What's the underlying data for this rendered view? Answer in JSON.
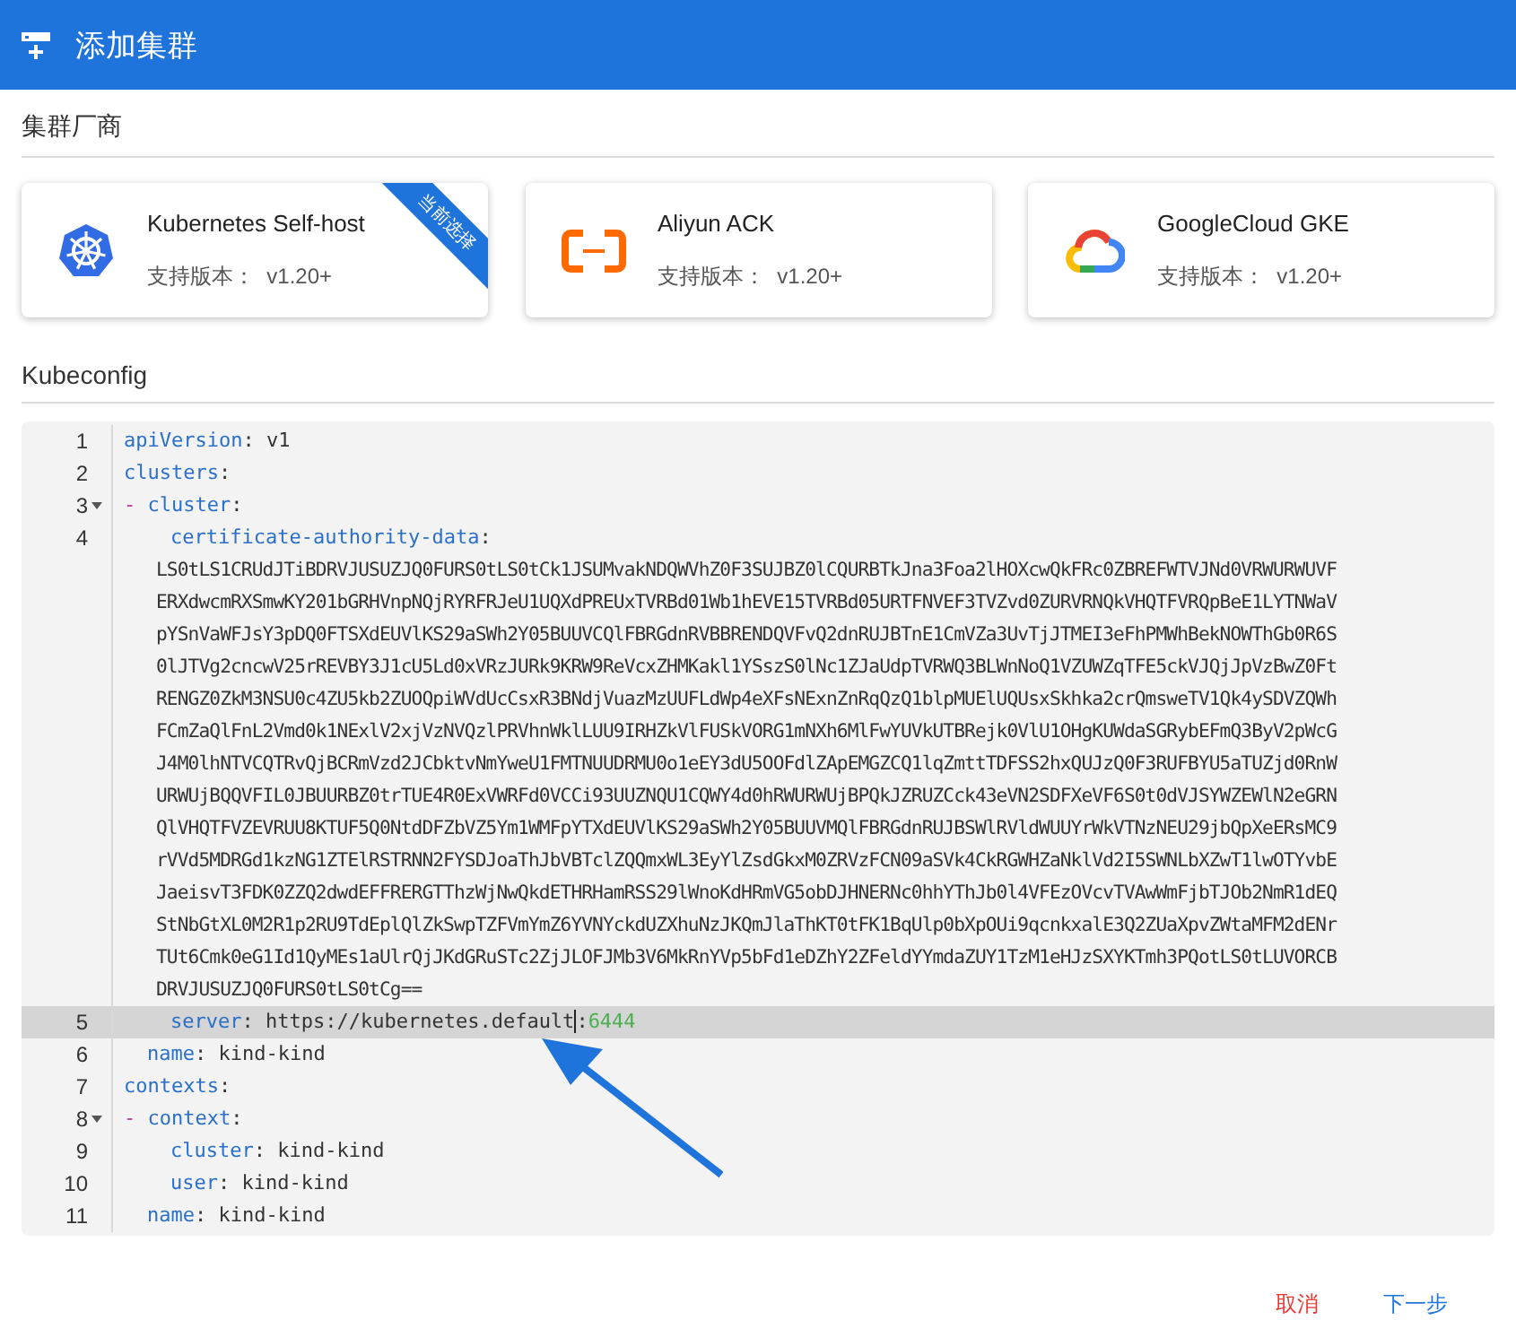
{
  "header": {
    "title": "添加集群"
  },
  "vendor_section": {
    "title": "集群厂商",
    "cards": [
      {
        "kind": "kubernetes",
        "name": "Kubernetes Self-host",
        "version_label": "支持版本：",
        "version": "v1.20+",
        "selected": true,
        "badge": "当前选择"
      },
      {
        "kind": "aliyun",
        "name": "Aliyun ACK",
        "version_label": "支持版本：",
        "version": "v1.20+",
        "selected": false
      },
      {
        "kind": "google-cloud",
        "name": "GoogleCloud GKE",
        "version_label": "支持版本：",
        "version": "v1.20+",
        "selected": false
      }
    ]
  },
  "kubeconfig_section": {
    "title": "Kubeconfig",
    "lines": [
      {
        "number": "1",
        "foldable": false,
        "highlighted": false,
        "parts": [
          {
            "kind": "key",
            "text": "apiVersion"
          },
          {
            "kind": "plain",
            "text": ": v1"
          }
        ]
      },
      {
        "number": "2",
        "foldable": false,
        "highlighted": false,
        "parts": [
          {
            "kind": "key",
            "text": "clusters"
          },
          {
            "kind": "plain",
            "text": ":"
          }
        ]
      },
      {
        "number": "3",
        "foldable": true,
        "highlighted": false,
        "parts": [
          {
            "kind": "dash",
            "text": "- "
          },
          {
            "kind": "key",
            "text": "cluster"
          },
          {
            "kind": "plain",
            "text": ":"
          }
        ]
      },
      {
        "number": "4",
        "kind": "deep",
        "foldable": false,
        "highlighted": false,
        "parts": [
          {
            "kind": "key",
            "text": "certificate-authority-data"
          },
          {
            "kind": "plain",
            "text": ":"
          }
        ],
        "wrapped": [
          "LS0tLS1CRUdJTiBDRVJUSUZJQ0FURS0tLS0tCk1JSUMvakNDQWVhZ0F3SUJBZ0lCQURBTkJna3Foa2lHOXcwQkFRc0ZBREFWTVJNd0VRWURWUVF",
          "ERXdwcmRXSmwKY201bGRHVnpNQjRYRFRJeU1UQXdPREUxTVRBd01Wb1hEVE15TVRBd05URTFNVEF3TVZvd0ZURVRNQkVHQTFVRQpBeE1LYTNWaV",
          "pYSnVaWFJsY3pDQ0FTSXdEUVlKS29aSWh2Y05BUUVCQlFBRGdnRVBBRENDQVFvQ2dnRUJBTnE1CmVZa3UvTjJTMEI3eFhPMWhBekNOWThGb0R6S",
          "0lJTVg2cncwV25rREVBY3J1cU5Ld0xVRzJURk9KRW9ReVcxZHMKakl1YSszS0lNc1ZJaUdpTVRWQ3BLWnNoQ1VZUWZqTFE5ckVJQjJpVzBwZ0Ft",
          "RENGZ0ZkM3NSU0c4ZU5kb2ZUOQpiWVdUcCsxR3BNdjVuazMzUUFLdWp4eXFsNExnZnRqQzQ1blpMUElUQUsxSkhka2crQmsweTV1Qk4ySDVZQWh",
          "FCmZaQlFnL2Vmd0k1NExlV2xjVzNVQzlPRVhnWklLUU9IRHZkVlFUSkVORG1mNXh6MlFwYUVkUTBRejk0VlU1OHgKUWdaSGRybEFmQ3ByV2pWcG",
          "J4M0lhNTVCQTRvQjBCRmVzd2JCbktvNmYweU1FMTNUUDRMU0o1eEY3dU5OOFdlZApEMGZCQ1lqZmttTDFSS2hxQUJzQ0F3RUFBYU5aTUZjd0RnW",
          "URWUjBQQVFIL0JBUURBZ0trTUE4R0ExVWRFd0VCCi93UUZNQU1CQWY4d0hRWURWUjBPQkJZRUZCck43eVN2SDFXeVF6S0t0dVJSYWZEWlN2eGRN",
          "QlVHQTFVZEVRUU8KTUF5Q0NtdDFZbVZ5Ym1WMFpYTXdEUVlKS29aSWh2Y05BUUVMQlFBRGdnRUJBSWlRVldWUUYrWkVTNzNEU29jbQpXeERsMC9",
          "rVVd5MDRGd1kzNG1ZTElRSTRNN2FYSDJoaThJbVBTclZQQmxWL3EyYlZsdGkxM0ZRVzFCN09aSVk4CkRGWHZaNklVd2I5SWNLbXZwT1lwOTYvbE",
          "JaeisvT3FDK0ZZQ2dwdEFFRERGTThzWjNwQkdETHRHamRSS29lWnoKdHRmVG5obDJHNERNc0hhYThJb0l4VFEzOVcvTVAwWmFjbTJOb2NmR1dEQ",
          "StNbGtXL0M2R1p2RU9TdEplQlZkSwpTZFVmYmZ6YVNYckdUZXhuNzJKQmJlaThKT0tFK1BqUlp0bXpOUi9qcnkxalE3Q2ZUaXpvZWtaMFM2dENr",
          "TUt6Cmk0eG1Id1QyMEs1aUlrQjJKdGRuSTc2ZjJLOFJMb3V6MkRnYVp5bFd1eDZhY2ZFeldYYmdaZUY1TzM1eHJzSXYKTmh3PQotLS0tLUVORCB",
          "DRVJUSUZJQ0FURS0tLS0tCg=="
        ]
      },
      {
        "number": "5",
        "kind": "deep",
        "foldable": false,
        "highlighted": true,
        "parts": [
          {
            "kind": "key",
            "text": "server"
          },
          {
            "kind": "plain",
            "text": ": https://kubernetes.default"
          },
          {
            "kind": "cursor",
            "text": ":"
          },
          {
            "kind": "number",
            "text": "6444"
          }
        ]
      },
      {
        "number": "6",
        "kind": "nested",
        "foldable": false,
        "highlighted": false,
        "parts": [
          {
            "kind": "key",
            "text": "name"
          },
          {
            "kind": "plain",
            "text": ": kind-kind"
          }
        ]
      },
      {
        "number": "7",
        "foldable": false,
        "highlighted": false,
        "parts": [
          {
            "kind": "key",
            "text": "contexts"
          },
          {
            "kind": "plain",
            "text": ":"
          }
        ]
      },
      {
        "number": "8",
        "foldable": true,
        "highlighted": false,
        "parts": [
          {
            "kind": "dash",
            "text": "- "
          },
          {
            "kind": "key",
            "text": "context"
          },
          {
            "kind": "plain",
            "text": ":"
          }
        ]
      },
      {
        "number": "9",
        "kind": "deep",
        "foldable": false,
        "highlighted": false,
        "parts": [
          {
            "kind": "key",
            "text": "cluster"
          },
          {
            "kind": "plain",
            "text": ": kind-kind"
          }
        ]
      },
      {
        "number": "10",
        "kind": "deep",
        "foldable": false,
        "highlighted": false,
        "parts": [
          {
            "kind": "key",
            "text": "user"
          },
          {
            "kind": "plain",
            "text": ": kind-kind"
          }
        ]
      },
      {
        "number": "11",
        "kind": "nested",
        "foldable": false,
        "highlighted": false,
        "parts": [
          {
            "kind": "key",
            "text": "name"
          },
          {
            "kind": "plain",
            "text": ": kind-kind"
          }
        ]
      }
    ]
  },
  "actions": [
    {
      "kind": "cancel",
      "label": "取消"
    },
    {
      "kind": "next",
      "label": "下一步"
    }
  ]
}
